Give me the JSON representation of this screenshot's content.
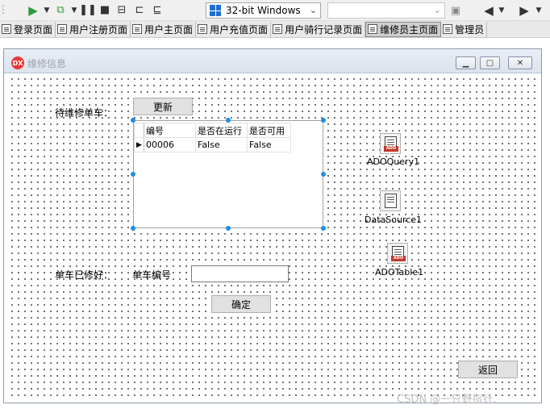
{
  "toolbar": {
    "platform_value": "32-bit Windows",
    "search_value": ""
  },
  "tabs": [
    {
      "label": "登录页面"
    },
    {
      "label": "用户注册页面"
    },
    {
      "label": "用户主页面"
    },
    {
      "label": "用户充值页面"
    },
    {
      "label": "用户骑行记录页面"
    },
    {
      "label": "维修员主页面",
      "active": true
    },
    {
      "label": "管理员"
    }
  ],
  "form": {
    "title": "维修信息",
    "logo_text": "DX",
    "label_pending": "待维修单车：",
    "refresh_button": "更新",
    "grid": {
      "columns": [
        "编号",
        "是否在运行",
        "是否可用"
      ],
      "rows": [
        [
          "00006",
          "False",
          "False"
        ]
      ]
    },
    "label_repaired": "单车已修好：",
    "label_bike_no": "单车编号",
    "bike_no_value": "",
    "confirm_button": "确定",
    "back_button": "返回",
    "components": {
      "adoquery": "ADOQuery1",
      "datasource": "DataSource1",
      "adotable": "ADOTable1",
      "ado_tag": "ADO"
    }
  },
  "watermark": "CSDN @一只野指针."
}
